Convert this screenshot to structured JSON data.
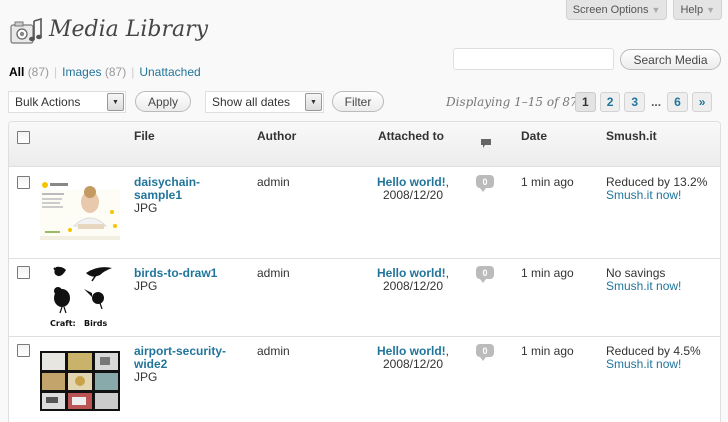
{
  "screen_meta": {
    "screen_options": "Screen Options",
    "help": "Help"
  },
  "page_title": "Media Library",
  "filters": [
    {
      "label": "All",
      "count": "(87)",
      "current": true
    },
    {
      "label": "Images",
      "count": "(87)",
      "current": false
    },
    {
      "label": "Unattached",
      "count": "",
      "current": false
    }
  ],
  "search": {
    "value": "",
    "button": "Search Media"
  },
  "toolbar": {
    "bulk_actions": "Bulk Actions",
    "apply": "Apply",
    "dates": "Show all dates",
    "filter": "Filter"
  },
  "pagination": {
    "displaying": "Displaying 1–15 of 87",
    "pages": [
      "1",
      "2",
      "3",
      "...",
      "6",
      "»"
    ],
    "current": "1"
  },
  "columns": {
    "file": "File",
    "author": "Author",
    "attached_to": "Attached to",
    "date": "Date",
    "smush": "Smush.it"
  },
  "rows": [
    {
      "file": "daisychain-sample1",
      "type": "JPG",
      "author": "admin",
      "attached_title": "Hello world!",
      "attached_date": "2008/12/20",
      "comments": "0",
      "date": "1 min ago",
      "smush_status": "Reduced by 13.2%",
      "smush_action": "Smush.it now!"
    },
    {
      "file": "birds-to-draw1",
      "type": "JPG",
      "author": "admin",
      "attached_title": "Hello world!",
      "attached_date": "2008/12/20",
      "comments": "0",
      "date": "1 min ago",
      "smush_status": "No savings",
      "smush_action": "Smush.it now!"
    },
    {
      "file": "airport-security-wide2",
      "type": "JPG",
      "author": "admin",
      "attached_title": "Hello world!",
      "attached_date": "2008/12/20",
      "comments": "0",
      "date": "1 min ago",
      "smush_status": "Reduced by 4.5%",
      "smush_action": "Smush.it now!"
    }
  ],
  "thumbnail_text": {
    "birds_caption_1": "Craft:",
    "birds_caption_2": "Birds"
  }
}
